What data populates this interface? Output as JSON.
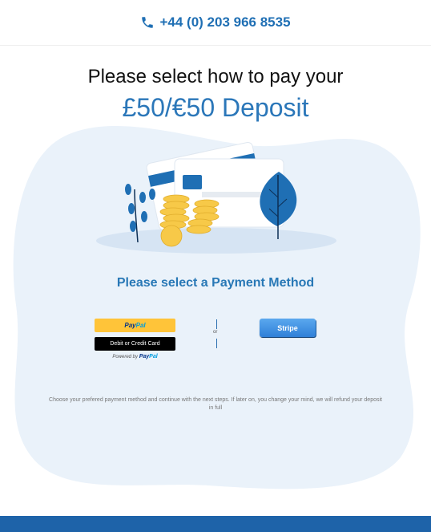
{
  "header": {
    "phone": "+44 (0) 203 966 8535",
    "phone_icon": "phone-icon"
  },
  "main": {
    "title_line1": "Please select how to pay your",
    "title_line2": "£50/€50 Deposit",
    "payment_method_title": "Please select a Payment Method",
    "paypal": {
      "pay": "Pay",
      "pal": "Pal",
      "card_button": "Debit or Credit Card",
      "powered_by": "Powered by",
      "powered_pay": "Pay",
      "powered_pal": "Pal"
    },
    "or_label": "or",
    "stripe_button": "Stripe",
    "note": "Choose your prefered payment method and continue with the next steps. If later on, you change your mind, we will refund your deposit in full"
  },
  "colors": {
    "accent": "#2b77b9",
    "footer": "#1e63a9",
    "paypal_yellow": "#ffc439",
    "blob": "#eaf2fa"
  }
}
